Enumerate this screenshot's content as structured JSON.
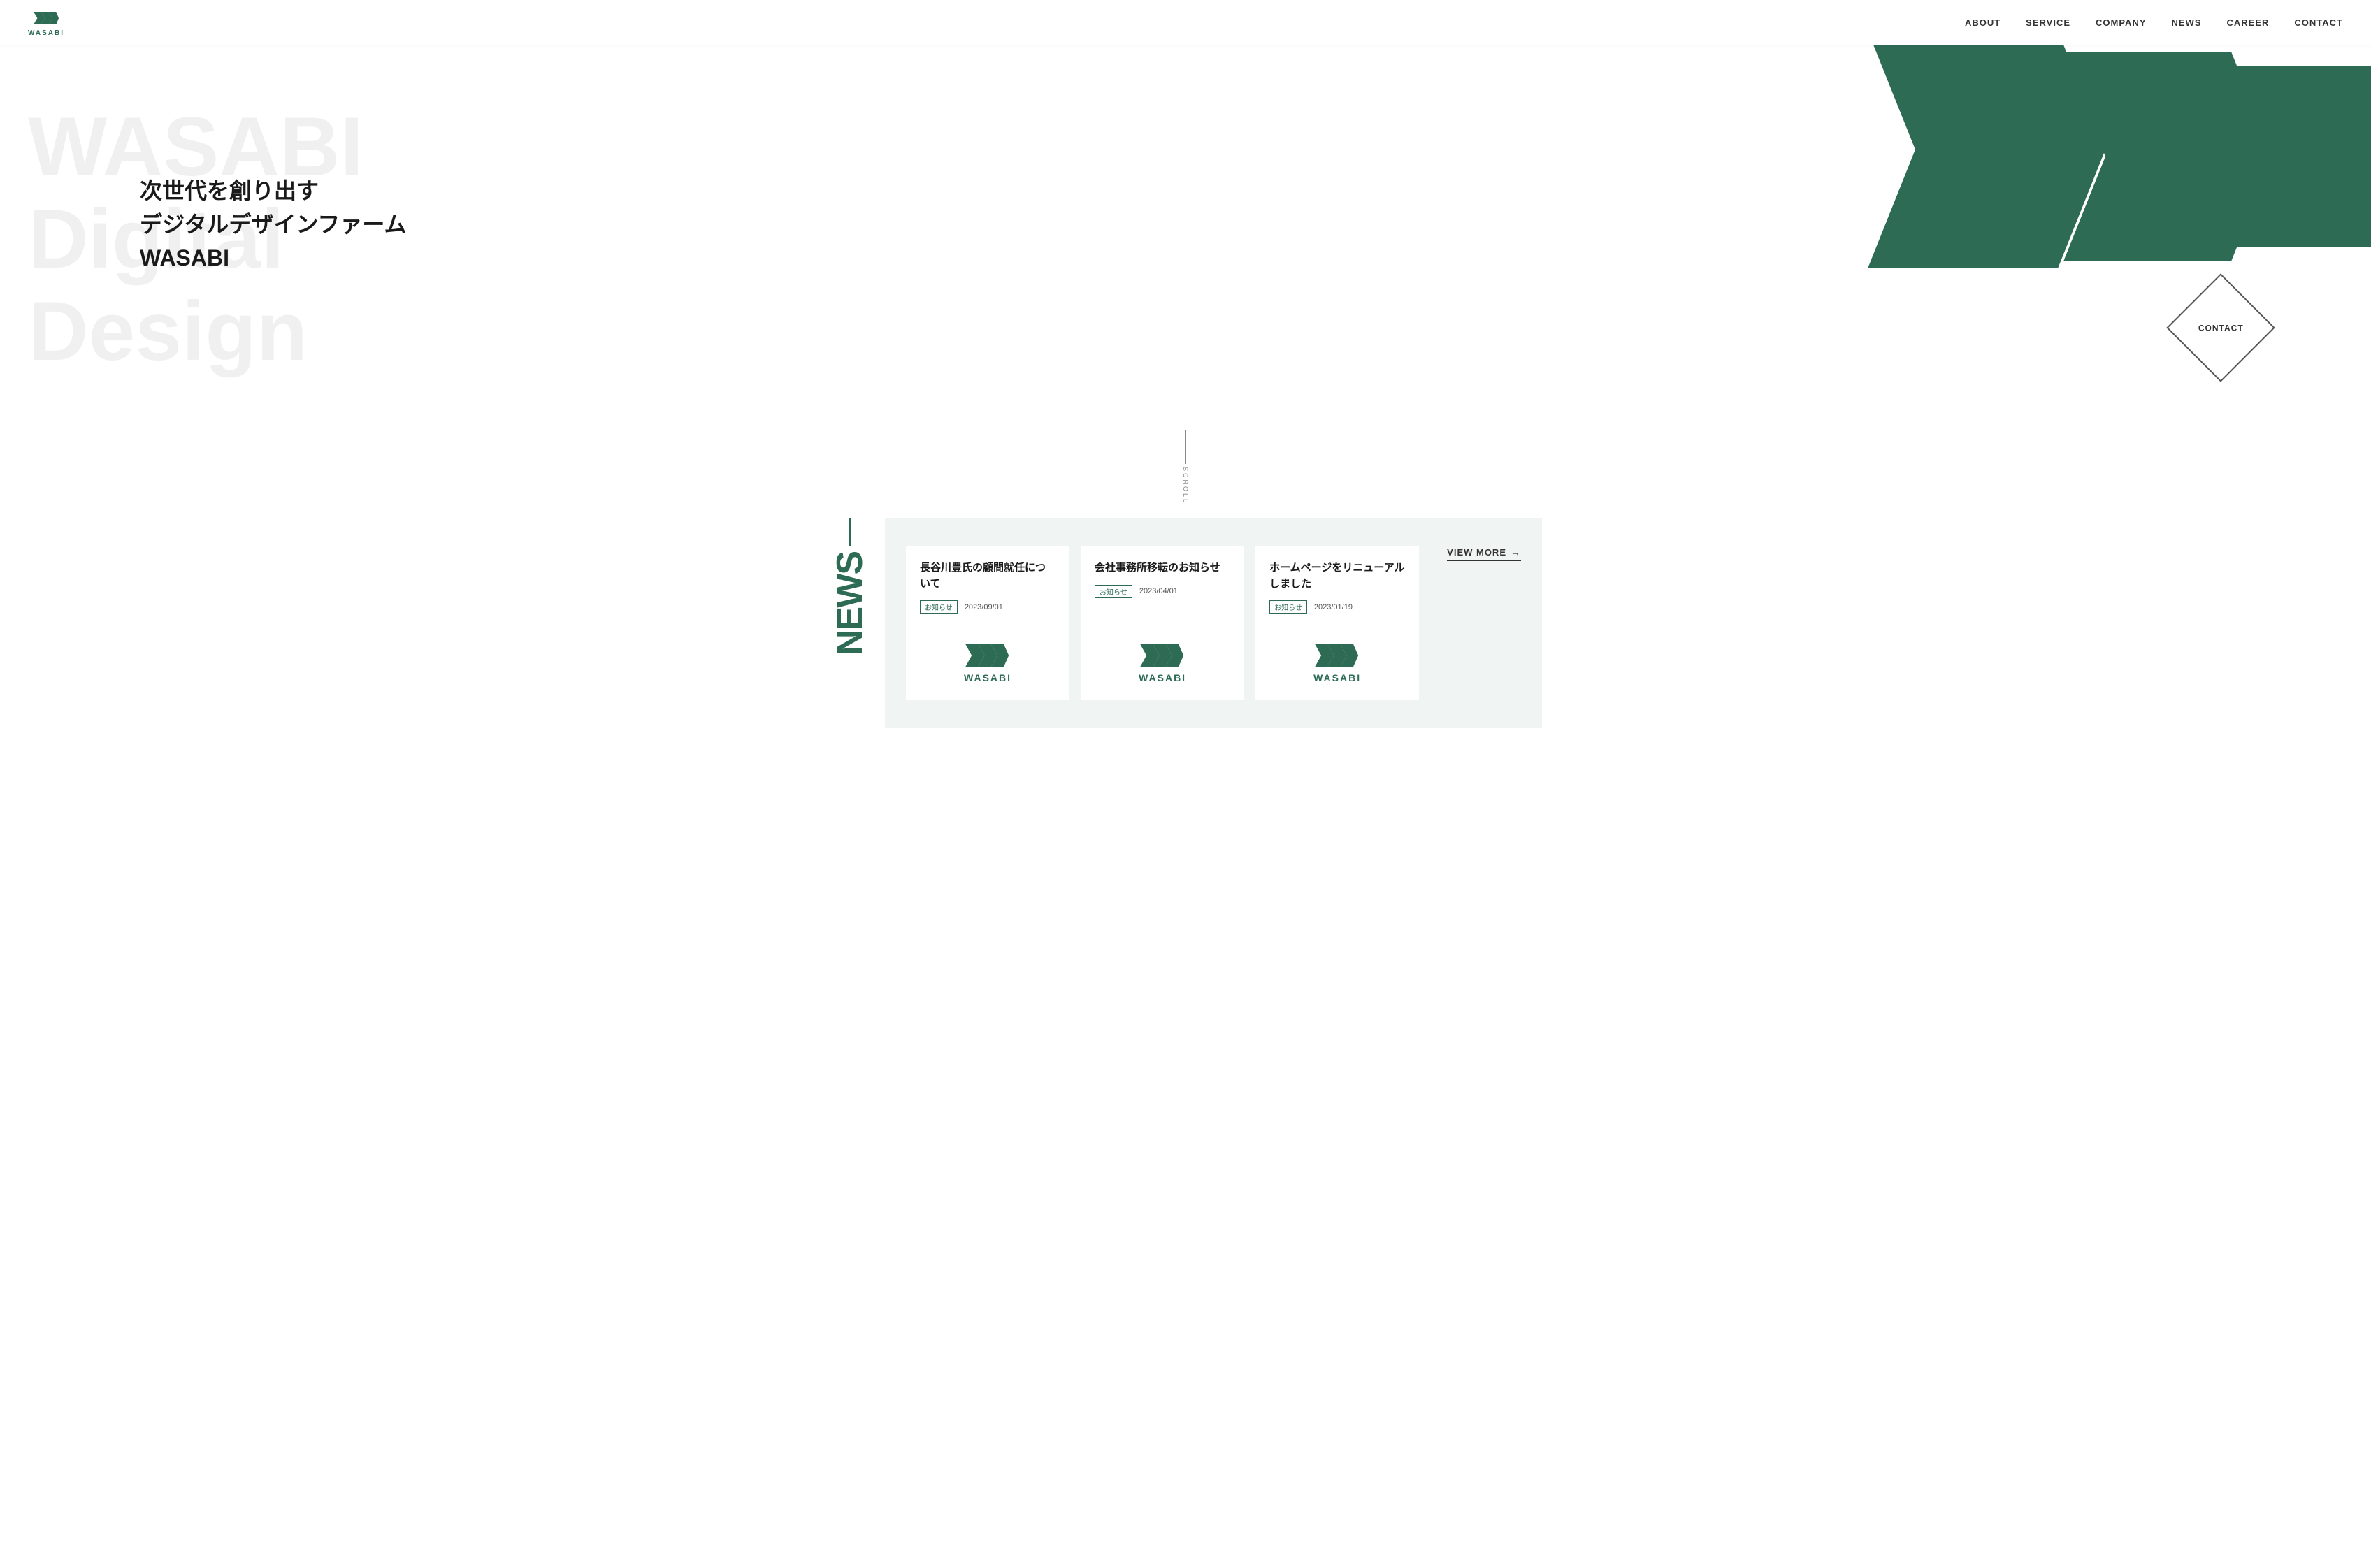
{
  "header": {
    "logo_text": "WASABI",
    "nav_items": [
      {
        "label": "ABOUT",
        "href": "#"
      },
      {
        "label": "SERVICE",
        "href": "#"
      },
      {
        "label": "COMPANY",
        "href": "#"
      },
      {
        "label": "NEWS",
        "href": "#"
      },
      {
        "label": "CAREER",
        "href": "#"
      },
      {
        "label": "CONTACT",
        "href": "#"
      }
    ]
  },
  "hero": {
    "bg_text_line1": "WASABI",
    "bg_text_line2": "Digital",
    "bg_text_line3": "Design",
    "copy_line1": "次世代を創り出す",
    "copy_line2": "デジタルデザインファーム",
    "copy_line3": "WASABI",
    "contact_label": "CONTACT"
  },
  "scroll": {
    "text": "SCROLL"
  },
  "news": {
    "section_label": "NEWS",
    "cards": [
      {
        "title": "長谷川豊氏の顧問就任について",
        "tag": "お知らせ",
        "date": "2023/09/01"
      },
      {
        "title": "会社事務所移転のお知らせ",
        "tag": "お知らせ",
        "date": "2023/04/01"
      },
      {
        "title": "ホームページをリニューアルしました",
        "tag": "お知らせ",
        "date": "2023/01/19"
      }
    ],
    "card_logo_text": "WASABI",
    "view_more_label": "VIEW MORE"
  }
}
